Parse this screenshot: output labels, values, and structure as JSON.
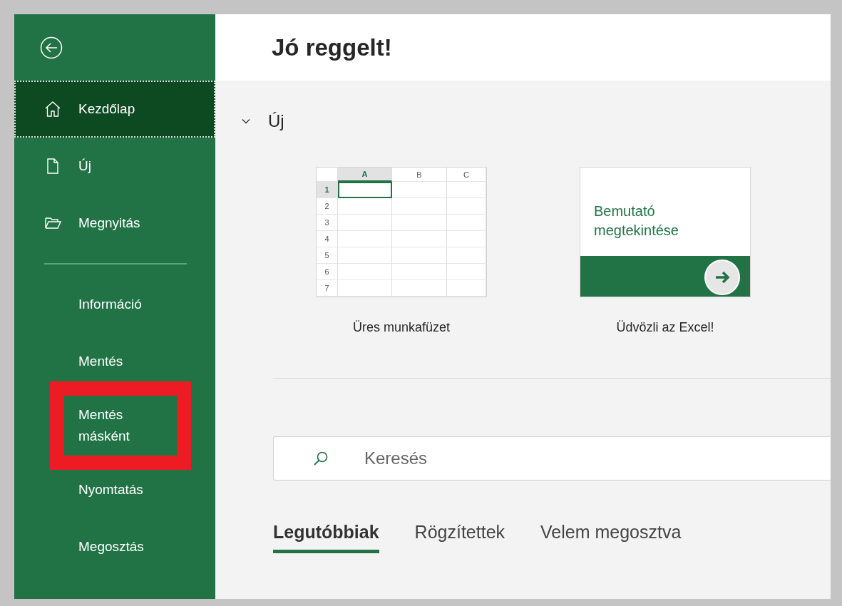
{
  "sidebar": {
    "items": [
      {
        "label": "Kezdőlap",
        "kind": "home",
        "selected": true,
        "highlighted": false
      },
      {
        "label": "Új",
        "kind": "file",
        "selected": false,
        "highlighted": false
      },
      {
        "label": "Megnyitás",
        "kind": "folder",
        "selected": false,
        "highlighted": false
      },
      {
        "kind": "divider"
      },
      {
        "label": "Információ",
        "selected": false,
        "highlighted": false
      },
      {
        "label": "Mentés",
        "selected": false,
        "highlighted": false
      },
      {
        "label": "Mentés\nmásként",
        "selected": false,
        "highlighted": true
      },
      {
        "label": "Nyomtatás",
        "selected": false,
        "highlighted": false
      },
      {
        "label": "Megosztás",
        "selected": false,
        "highlighted": false
      }
    ]
  },
  "header": {
    "title": "Jó reggelt!"
  },
  "new_section": {
    "title": "Új",
    "expanded": true,
    "templates": [
      {
        "kind": "blank",
        "label": "Üres munkafüzet",
        "columns": [
          "A",
          "B",
          "C"
        ],
        "rows": [
          "1",
          "2",
          "3",
          "4",
          "5",
          "6",
          "7"
        ]
      },
      {
        "kind": "tour",
        "label": "Üdvözli az Excel!",
        "card_text": "Bemutató\nmegtekintése"
      }
    ]
  },
  "search": {
    "placeholder": "Keresés"
  },
  "tabs": [
    {
      "label": "Legutóbbiak",
      "selected": true
    },
    {
      "label": "Rögzítettek",
      "selected": false
    },
    {
      "label": "Velem megosztva",
      "selected": false
    }
  ]
}
